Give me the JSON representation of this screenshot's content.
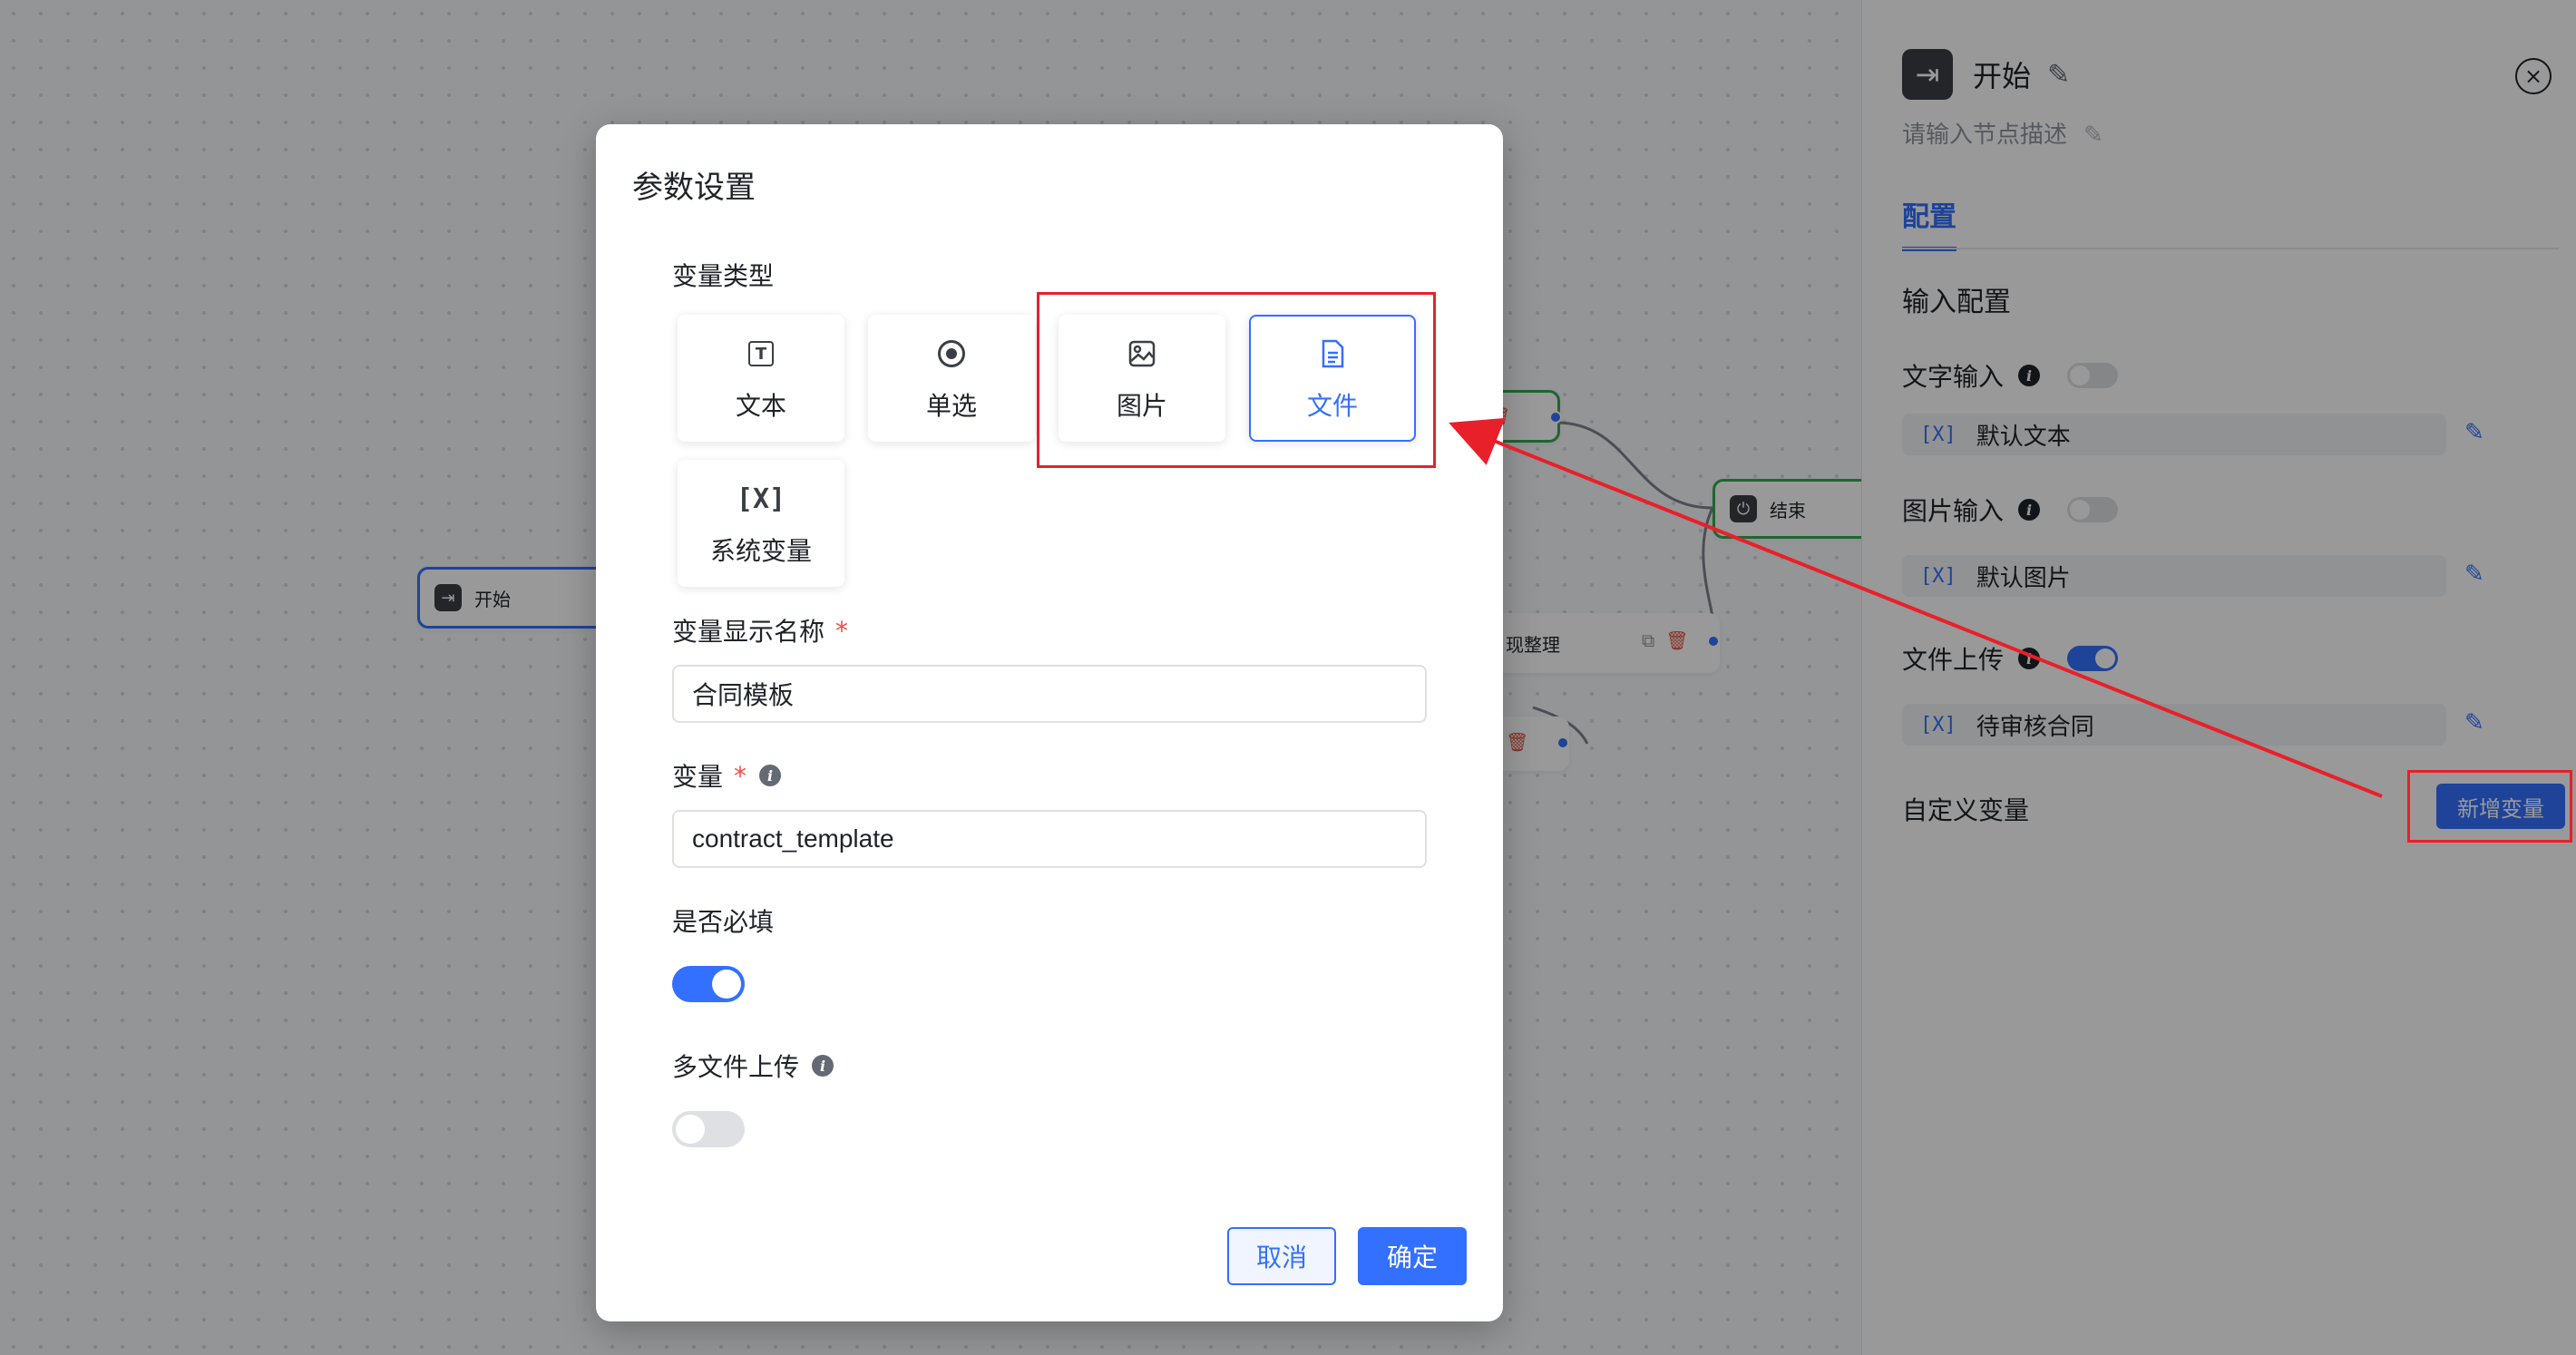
{
  "canvas": {
    "start_node": {
      "label": "开始"
    },
    "end_node": {
      "label": "结束"
    },
    "tidy_node": {
      "label": "现整理"
    }
  },
  "right_panel": {
    "title": "开始",
    "description_placeholder": "请输入节点描述",
    "tab": "配置",
    "section": "输入配置",
    "text_input": {
      "label": "文字输入",
      "enabled": false,
      "variable": "默认文本"
    },
    "image_input": {
      "label": "图片输入",
      "enabled": false,
      "variable": "默认图片"
    },
    "file_upload": {
      "label": "文件上传",
      "enabled": true,
      "variable": "待审核合同"
    },
    "custom_vars_label": "自定义变量",
    "add_var_button": "新增变量"
  },
  "modal": {
    "title": "参数设置",
    "var_type_label": "变量类型",
    "types": [
      {
        "label": "文本",
        "icon": "text-box-icon",
        "selected": false
      },
      {
        "label": "单选",
        "icon": "radio-icon",
        "selected": false
      },
      {
        "label": "图片",
        "icon": "image-icon",
        "selected": false
      },
      {
        "label": "文件",
        "icon": "file-icon",
        "selected": true
      },
      {
        "label": "系统变量",
        "icon": "variable-icon",
        "selected": false
      }
    ],
    "display_name_label": "变量显示名称",
    "display_name_value": "合同模板",
    "variable_label": "变量",
    "variable_value": "contract_template",
    "required_label": "是否必填",
    "required_on": true,
    "multi_upload_label": "多文件上传",
    "multi_upload_on": false,
    "cancel": "取消",
    "confirm": "确定",
    "required_mark": "*"
  },
  "icons": {
    "text_glyph": "T",
    "variable_glyph": "[X]",
    "x_glyph": "[X]",
    "info_glyph": "i",
    "close_glyph": "×"
  },
  "colors": {
    "primary": "#3370ff",
    "annotation": "#e8202a",
    "success": "#34a853"
  }
}
